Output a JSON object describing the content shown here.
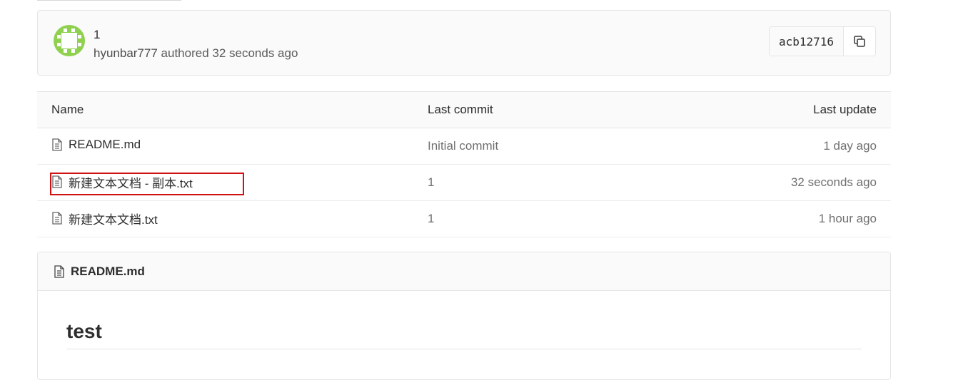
{
  "commit": {
    "title": "1",
    "author": "hyunbar777",
    "authored_text": "authored 32 seconds ago",
    "sha": "acb12716",
    "avatar_color": "#8fd14f",
    "copy_icon": "copy-icon"
  },
  "tree": {
    "headers": {
      "name": "Name",
      "last_commit": "Last commit",
      "last_update": "Last update"
    },
    "rows": [
      {
        "name": "README.md",
        "last_commit": "Initial commit",
        "last_update": "1 day ago",
        "icon": "file-text-icon"
      },
      {
        "name": "新建文本文档 - 副本.txt",
        "last_commit": "1",
        "last_update": "32 seconds ago",
        "icon": "file-text-icon",
        "highlighted": true
      },
      {
        "name": "新建文本文档.txt",
        "last_commit": "1",
        "last_update": "1 hour ago",
        "icon": "file-text-icon"
      }
    ]
  },
  "readme": {
    "filename": "README.md",
    "heading": "test"
  },
  "colors": {
    "highlight": "#d01010",
    "border": "#e5e5e5",
    "header_bg": "#fafafa"
  }
}
